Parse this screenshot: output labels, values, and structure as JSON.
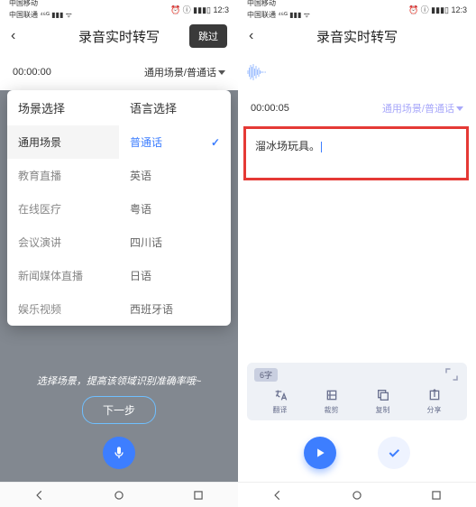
{
  "status": {
    "carrier_lines": "中国移动 / 中国联通",
    "signal": "⁴⁶ ᴳ ▮▮▮▮ ▮▮▮ ᯤ",
    "right": "⏰ ⓘ ▮▮▮▯ 12:3"
  },
  "left": {
    "title": "录音实时转写",
    "skip": "跳过",
    "time": "00:00:00",
    "scene_lang": "通用场景/普通话",
    "pop_header_left": "场景选择",
    "pop_header_right": "语言选择",
    "scenes": [
      "通用场景",
      "教育直播",
      "在线医疗",
      "会议演讲",
      "新闻媒体直播",
      "娱乐视频"
    ],
    "langs": [
      "普通话",
      "英语",
      "粤语",
      "四川话",
      "日语",
      "西班牙语"
    ],
    "hint": "选择场景，提高该领域识别准确率哦~",
    "next": "下一步"
  },
  "right": {
    "title": "录音实时转写",
    "time": "00:00:05",
    "scene_lang": "通用场景/普通话",
    "transcript": "溜冰场玩具。",
    "word_count": "6字",
    "tools": {
      "translate": "翻译",
      "cut": "裁剪",
      "copy": "复制",
      "share": "分享"
    }
  }
}
